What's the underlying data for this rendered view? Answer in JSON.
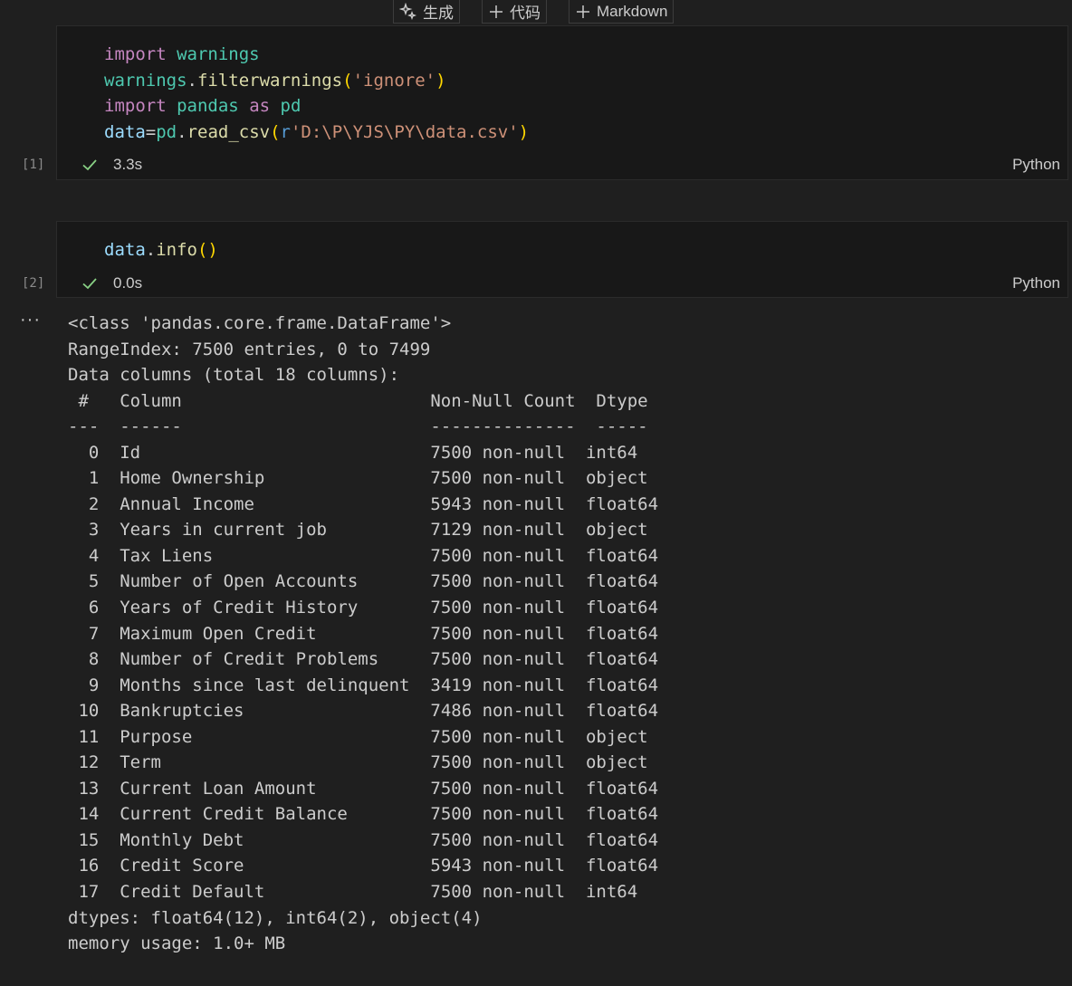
{
  "toolbar": {
    "generate_label": "生成",
    "code_label": "代码",
    "markdown_label": "Markdown"
  },
  "cells": [
    {
      "exec_count": "[1]",
      "duration": "3.3s",
      "language": "Python",
      "code_lines": [
        [
          [
            "kw",
            "import"
          ],
          [
            "punc",
            " "
          ],
          [
            "mod",
            "warnings"
          ]
        ],
        [
          [
            "mod",
            "warnings"
          ],
          [
            "punc",
            "."
          ],
          [
            "fn",
            "filterwarnings"
          ],
          [
            "paren",
            "("
          ],
          [
            "str",
            "'ignore'"
          ],
          [
            "paren",
            ")"
          ]
        ],
        [
          [
            "kw",
            "import"
          ],
          [
            "punc",
            " "
          ],
          [
            "mod",
            "pandas"
          ],
          [
            "punc",
            " "
          ],
          [
            "kw",
            "as"
          ],
          [
            "punc",
            " "
          ],
          [
            "mod",
            "pd"
          ]
        ],
        [
          [
            "var",
            "data"
          ],
          [
            "punc",
            "="
          ],
          [
            "mod",
            "pd"
          ],
          [
            "punc",
            "."
          ],
          [
            "fn",
            "read_csv"
          ],
          [
            "paren",
            "("
          ],
          [
            "rprefix",
            "r"
          ],
          [
            "str",
            "'D:\\P\\YJS\\PY\\data.csv'"
          ],
          [
            "paren",
            ")"
          ]
        ]
      ]
    },
    {
      "exec_count": "[2]",
      "duration": "0.0s",
      "language": "Python",
      "code_lines": [
        [
          [
            "var",
            "data"
          ],
          [
            "punc",
            "."
          ],
          [
            "fn",
            "info"
          ],
          [
            "paren",
            "()"
          ]
        ]
      ]
    }
  ],
  "output": {
    "more_label": "···",
    "header_lines": [
      "<class 'pandas.core.frame.DataFrame'>",
      "RangeIndex: 7500 entries, 0 to 7499",
      "Data columns (total 18 columns):",
      " #   Column                        Non-Null Count  Dtype  ",
      "---  ------                        --------------  -----  "
    ],
    "rows": [
      {
        "idx": "0",
        "column": "Id",
        "non_null": "7500 non-null",
        "dtype": "int64"
      },
      {
        "idx": "1",
        "column": "Home Ownership",
        "non_null": "7500 non-null",
        "dtype": "object"
      },
      {
        "idx": "2",
        "column": "Annual Income",
        "non_null": "5943 non-null",
        "dtype": "float64"
      },
      {
        "idx": "3",
        "column": "Years in current job",
        "non_null": "7129 non-null",
        "dtype": "object"
      },
      {
        "idx": "4",
        "column": "Tax Liens",
        "non_null": "7500 non-null",
        "dtype": "float64"
      },
      {
        "idx": "5",
        "column": "Number of Open Accounts",
        "non_null": "7500 non-null",
        "dtype": "float64"
      },
      {
        "idx": "6",
        "column": "Years of Credit History",
        "non_null": "7500 non-null",
        "dtype": "float64"
      },
      {
        "idx": "7",
        "column": "Maximum Open Credit",
        "non_null": "7500 non-null",
        "dtype": "float64"
      },
      {
        "idx": "8",
        "column": "Number of Credit Problems",
        "non_null": "7500 non-null",
        "dtype": "float64"
      },
      {
        "idx": "9",
        "column": "Months since last delinquent",
        "non_null": "3419 non-null",
        "dtype": "float64"
      },
      {
        "idx": "10",
        "column": "Bankruptcies",
        "non_null": "7486 non-null",
        "dtype": "float64"
      },
      {
        "idx": "11",
        "column": "Purpose",
        "non_null": "7500 non-null",
        "dtype": "object"
      },
      {
        "idx": "12",
        "column": "Term",
        "non_null": "7500 non-null",
        "dtype": "object"
      },
      {
        "idx": "13",
        "column": "Current Loan Amount",
        "non_null": "7500 non-null",
        "dtype": "float64"
      },
      {
        "idx": "14",
        "column": "Current Credit Balance",
        "non_null": "7500 non-null",
        "dtype": "float64"
      },
      {
        "idx": "15",
        "column": "Monthly Debt",
        "non_null": "7500 non-null",
        "dtype": "float64"
      },
      {
        "idx": "16",
        "column": "Credit Score",
        "non_null": "5943 non-null",
        "dtype": "float64"
      },
      {
        "idx": "17",
        "column": "Credit Default",
        "non_null": "7500 non-null",
        "dtype": "int64"
      }
    ],
    "footer_lines": [
      "dtypes: float64(12), int64(2), object(4)",
      "memory usage: 1.0+ MB"
    ]
  }
}
